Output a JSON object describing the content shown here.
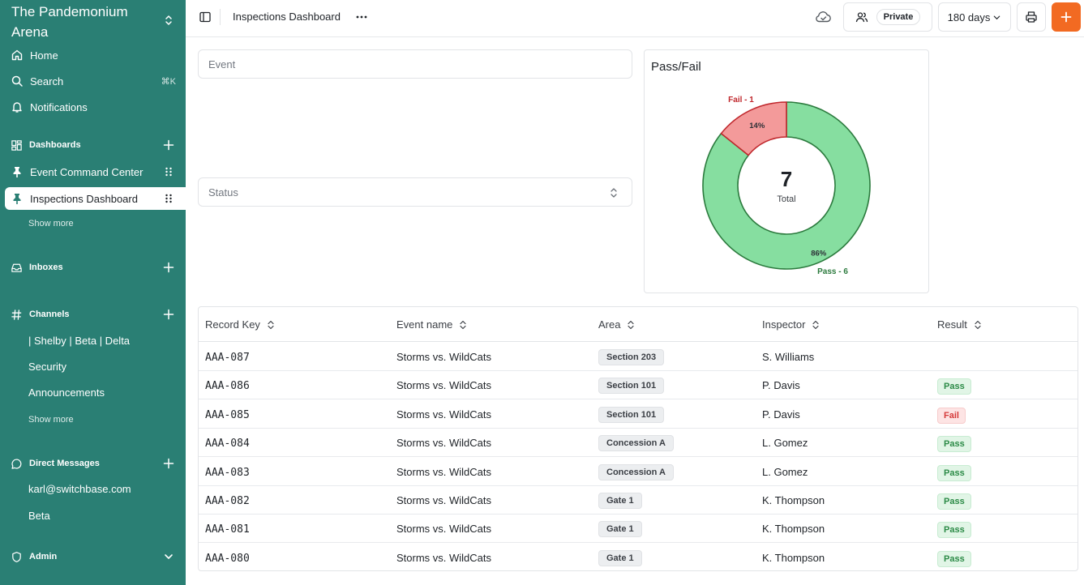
{
  "workspace": {
    "name": "The Pandemonium Arena"
  },
  "nav": {
    "home": "Home",
    "search": "Search",
    "search_shortcut": "⌘K",
    "notifications": "Notifications"
  },
  "dashboards": {
    "title": "Dashboards",
    "items": [
      {
        "label": "Event Command Center",
        "active": false
      },
      {
        "label": "Inspections Dashboard",
        "active": true
      }
    ],
    "show_more": "Show more"
  },
  "inboxes": {
    "title": "Inboxes"
  },
  "channels": {
    "title": "Channels",
    "items": [
      "| Shelby | Beta | Delta",
      "Security",
      "Announcements"
    ],
    "show_more": "Show more"
  },
  "direct_messages": {
    "title": "Direct Messages",
    "items": [
      "karl@switchbase.com",
      "Beta"
    ]
  },
  "admin": {
    "title": "Admin"
  },
  "topbar": {
    "title": "Inspections Dashboard",
    "private_label": "Private",
    "range_label": "180 days"
  },
  "filters": {
    "event_placeholder": "Event",
    "status_placeholder": "Status"
  },
  "chart_data": {
    "type": "pie",
    "title": "Pass/Fail",
    "center_value": "7",
    "center_label": "Total",
    "slices": [
      {
        "label": "Pass - 6",
        "value": 6,
        "percent": "86%",
        "color": "#86dea0",
        "text_color": "#2b7a3d"
      },
      {
        "label": "Fail - 1",
        "value": 1,
        "percent": "14%",
        "color": "#f39a9a",
        "text_color": "#c0282d"
      }
    ]
  },
  "table": {
    "columns": [
      "Record Key",
      "Event name",
      "Area",
      "Inspector",
      "Result"
    ],
    "rows": [
      {
        "key": "AAA-087",
        "event": "Storms vs. WildCats",
        "area": "Section 203",
        "inspector": "S. Williams",
        "result": ""
      },
      {
        "key": "AAA-086",
        "event": "Storms vs. WildCats",
        "area": "Section 101",
        "inspector": "P. Davis",
        "result": "Pass"
      },
      {
        "key": "AAA-085",
        "event": "Storms vs. WildCats",
        "area": "Section 101",
        "inspector": "P. Davis",
        "result": "Fail"
      },
      {
        "key": "AAA-084",
        "event": "Storms vs. WildCats",
        "area": "Concession A",
        "inspector": "L. Gomez",
        "result": "Pass"
      },
      {
        "key": "AAA-083",
        "event": "Storms vs. WildCats",
        "area": "Concession A",
        "inspector": "L. Gomez",
        "result": "Pass"
      },
      {
        "key": "AAA-082",
        "event": "Storms vs. WildCats",
        "area": "Gate 1",
        "inspector": "K. Thompson",
        "result": "Pass"
      },
      {
        "key": "AAA-081",
        "event": "Storms vs. WildCats",
        "area": "Gate 1",
        "inspector": "K. Thompson",
        "result": "Pass"
      },
      {
        "key": "AAA-080",
        "event": "Storms vs. WildCats",
        "area": "Gate 1",
        "inspector": "K. Thompson",
        "result": "Pass"
      }
    ]
  },
  "colors": {
    "sidebar": "#2a7f74",
    "accent": "#f26a22",
    "pass": "#2b8a46",
    "fail": "#d53a3a"
  }
}
